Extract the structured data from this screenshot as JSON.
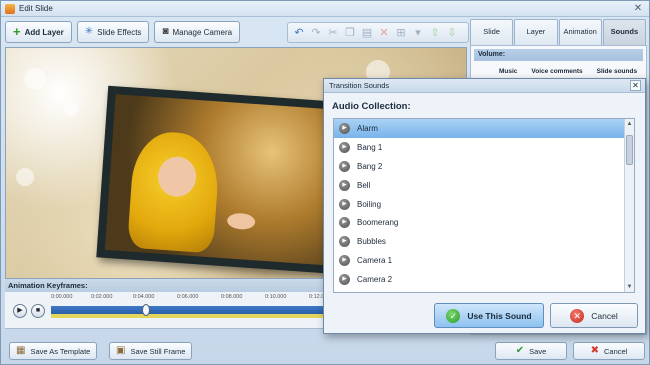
{
  "window": {
    "title": "Edit Slide"
  },
  "toolbar": {
    "add_layer": "Add Layer",
    "slide_effects": "Slide Effects",
    "manage_camera": "Manage Camera"
  },
  "tabs": [
    "Slide",
    "Layer",
    "Animation",
    "Sounds"
  ],
  "right_panel": {
    "section": "Volume:",
    "columns": [
      "Music",
      "Voice comments",
      "Slide sounds"
    ]
  },
  "timeline": {
    "label": "Animation Keyframes:",
    "ticks": [
      "0:00.000",
      "0:02.000",
      "0:04.000",
      "0:06.000",
      "0:08.000",
      "0:10.000",
      "0:12.0"
    ],
    "position": 0.34
  },
  "bottom": {
    "save_as_template": "Save As Template",
    "save_still_frame": "Save Still Frame",
    "save": "Save",
    "cancel": "Cancel"
  },
  "dialog": {
    "title": "Transition Sounds",
    "section_label": "Audio Collection:",
    "sounds": [
      "Alarm",
      "Bang 1",
      "Bang 2",
      "Bell",
      "Boiling",
      "Boomerang",
      "Bubbles",
      "Camera 1",
      "Camera 2"
    ],
    "selected": "Alarm",
    "use_button": "Use This Sound",
    "cancel_button": "Cancel"
  },
  "colors": {
    "selection": "#78b3ea",
    "timeline_track": "#2a5ea8",
    "ok_green": "#2e9b2a",
    "cancel_red": "#c6291c"
  }
}
